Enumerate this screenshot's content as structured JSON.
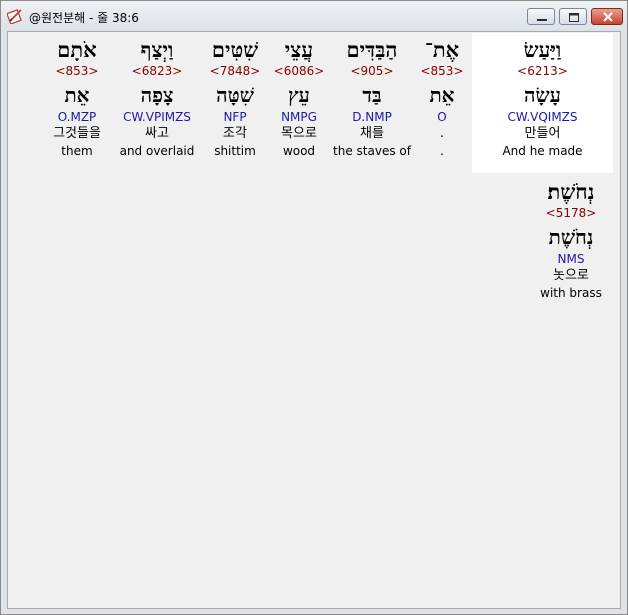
{
  "window": {
    "title": "@원전분해 - 줄 38:6"
  },
  "words": [
    {
      "hebrew": "וַיַּעַשׂ",
      "strong": "<6213>",
      "lemma": "עָשָׂה",
      "morph": "CW.VQIMZS",
      "korean": "만들어",
      "english": "And he made",
      "highlighted": true
    },
    {
      "hebrew": "אֶת־",
      "strong": "<853>",
      "lemma": "אֵת",
      "morph": "O",
      "korean": ".",
      "english": "."
    },
    {
      "hebrew": "הַבַּדִּים",
      "strong": "<905>",
      "lemma": "בַּד",
      "morph": "D.NMP",
      "korean": "채를",
      "english": "the staves of"
    },
    {
      "hebrew": "עֲצֵי",
      "strong": "<6086>",
      "lemma": "עֵץ",
      "morph": "NMPG",
      "korean": "목으로",
      "english": "wood"
    },
    {
      "hebrew": "שִׁטִּים",
      "strong": "<7848>",
      "lemma": "שִׁטָּה",
      "morph": "NFP",
      "korean": "조각",
      "english": "shittim"
    },
    {
      "hebrew": "וַיְצַף",
      "strong": "<6823>",
      "lemma": "צָפָה",
      "morph": "CW.VPIMZS",
      "korean": "싸고",
      "english": "and overlaid"
    },
    {
      "hebrew": "אֹתָם",
      "strong": "<853>",
      "lemma": "אֵת",
      "morph": "O.MZP",
      "korean": "그것들을",
      "english": "them"
    },
    {
      "hebrew": "נְחֹשֶׁת׃",
      "strong": "<5178>",
      "lemma": "נְחֹשֶׁת",
      "morph": "NMS",
      "korean": "놋으로",
      "english": "with brass"
    }
  ]
}
